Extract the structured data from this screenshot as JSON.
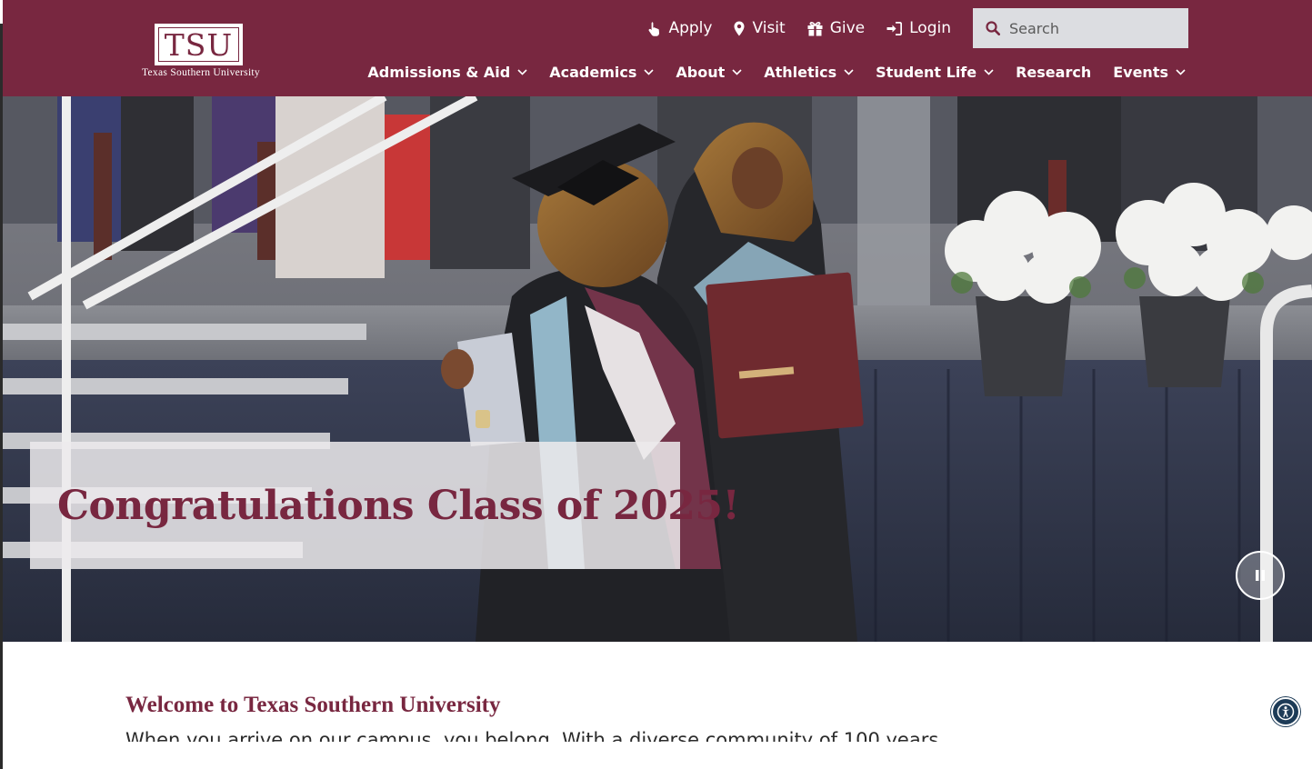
{
  "header": {
    "logo": {
      "letters": "TSU",
      "name": "Texas Southern University"
    },
    "utility_links": [
      {
        "label": "Apply",
        "icon": "hand-pointer-icon"
      },
      {
        "label": "Visit",
        "icon": "map-marker-icon"
      },
      {
        "label": "Give",
        "icon": "gift-icon"
      },
      {
        "label": "Login",
        "icon": "sign-in-icon"
      }
    ],
    "search": {
      "placeholder": "Search",
      "icon": "search-icon"
    },
    "nav": [
      {
        "label": "Admissions & Aid",
        "dropdown": true
      },
      {
        "label": "Academics",
        "dropdown": true
      },
      {
        "label": "About",
        "dropdown": true
      },
      {
        "label": "Athletics",
        "dropdown": true
      },
      {
        "label": "Student Life",
        "dropdown": true
      },
      {
        "label": "Research",
        "dropdown": false
      },
      {
        "label": "Events",
        "dropdown": true
      }
    ]
  },
  "hero": {
    "caption": "Congratulations Class of 2025!",
    "pause_icon": "pause-icon"
  },
  "welcome": {
    "title": "Welcome to Texas Southern University",
    "body_partial": "When you arrive on our campus, you belong. With a diverse community of 100 years..."
  },
  "accessibility": {
    "icon": "accessibility-icon"
  },
  "colors": {
    "brand": "#782740",
    "search_bg": "#dcdde1",
    "text_dark": "#2b2b2b"
  }
}
